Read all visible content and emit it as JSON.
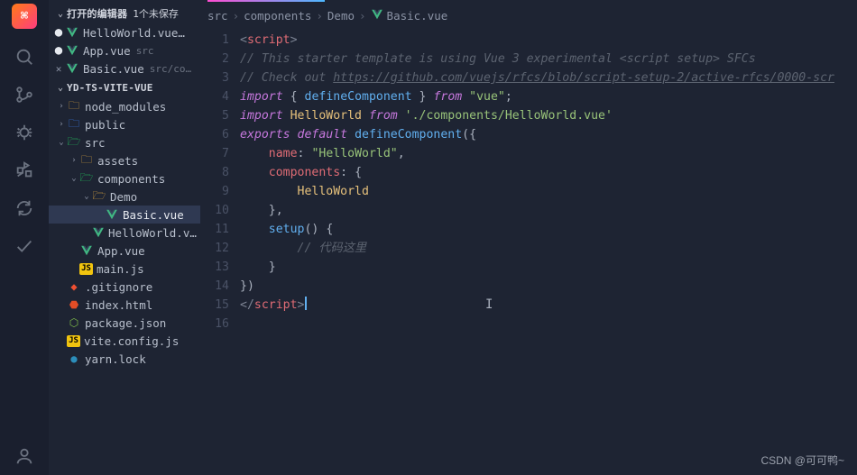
{
  "sidebar": {
    "openEditors": {
      "label": "打开的编辑器",
      "meta": "1个未保存",
      "items": [
        {
          "icon": "vue",
          "name": "HelloWorld.vue…",
          "dot": "●"
        },
        {
          "icon": "vue",
          "name": "App.vue",
          "meta": "src",
          "dot": "●"
        },
        {
          "icon": "vue",
          "name": "Basic.vue",
          "meta": "src/co…",
          "close": "✕"
        }
      ]
    },
    "project": {
      "name": "YD-TS-VITE-VUE"
    },
    "tree": [
      {
        "depth": 0,
        "chev": "›",
        "icon": "folder",
        "iconClass": "folder",
        "label": "node_modules"
      },
      {
        "depth": 0,
        "chev": "›",
        "icon": "folder",
        "iconClass": "folder-blue",
        "label": "public"
      },
      {
        "depth": 0,
        "chev": "⌄",
        "icon": "folder-open",
        "iconClass": "folder-green",
        "label": "src"
      },
      {
        "depth": 1,
        "chev": "›",
        "icon": "folder",
        "iconClass": "folder",
        "label": "assets"
      },
      {
        "depth": 1,
        "chev": "⌄",
        "icon": "folder-open",
        "iconClass": "folder-green",
        "label": "components"
      },
      {
        "depth": 2,
        "chev": "⌄",
        "icon": "folder-open",
        "iconClass": "folder",
        "label": "Demo"
      },
      {
        "depth": 3,
        "chev": "",
        "icon": "vue",
        "iconClass": "vue",
        "label": "Basic.vue",
        "selected": true
      },
      {
        "depth": 2,
        "chev": "",
        "icon": "vue",
        "iconClass": "vue",
        "label": "HelloWorld.vue"
      },
      {
        "depth": 1,
        "chev": "",
        "icon": "vue",
        "iconClass": "vue",
        "label": "App.vue"
      },
      {
        "depth": 1,
        "chev": "",
        "icon": "js",
        "iconClass": "js",
        "label": "main.js"
      },
      {
        "depth": 0,
        "chev": "",
        "icon": "git",
        "iconClass": "git",
        "label": ".gitignore"
      },
      {
        "depth": 0,
        "chev": "",
        "icon": "html",
        "iconClass": "html",
        "label": "index.html"
      },
      {
        "depth": 0,
        "chev": "",
        "icon": "json",
        "iconClass": "json",
        "label": "package.json"
      },
      {
        "depth": 0,
        "chev": "",
        "icon": "js",
        "iconClass": "js",
        "label": "vite.config.js"
      },
      {
        "depth": 0,
        "chev": "",
        "icon": "yarn",
        "iconClass": "yarn",
        "label": "yarn.lock"
      }
    ]
  },
  "breadcrumb": [
    "src",
    "components",
    "Demo",
    "Basic.vue"
  ],
  "code": {
    "lines": [
      {
        "n": 1,
        "html": ""
      },
      {
        "n": 2,
        "html": "<span class='tok-ang'>&lt;</span><span class='tok-tag'>script</span><span class='tok-ang'>&gt;</span>"
      },
      {
        "n": 3,
        "html": "<span class='tok-cmt'>// This starter template is using Vue 3 experimental &lt;script setup&gt; SFCs</span>"
      },
      {
        "n": 4,
        "html": "<span class='tok-cmt'>// Check out </span><span class='tok-link'>https://github.com/vuejs/rfcs/blob/script-setup-2/active-rfcs/0000-scr</span>"
      },
      {
        "n": 5,
        "html": "<span class='tok-key'>import</span> <span class='tok-pun'>{</span> <span class='tok-fn'>defineComponent</span> <span class='tok-pun'>}</span> <span class='tok-key'>from</span> <span class='tok-str'>\"vue\"</span><span class='tok-pun'>;</span>"
      },
      {
        "n": 6,
        "html": "<span class='tok-key'>import</span> <span class='tok-var'>HelloWorld</span> <span class='tok-key'>from</span> <span class='tok-str'>'./components/HelloWorld.vue'</span>"
      },
      {
        "n": 7,
        "html": "<span class='tok-key'>exports</span> <span class='tok-key'>default</span> <span class='tok-fn'>defineComponent</span><span class='tok-pun'>({</span>"
      },
      {
        "n": 8,
        "html": "    <span class='tok-prop'>name</span><span class='tok-pun'>:</span> <span class='tok-str'>\"HelloWorld\"</span><span class='tok-pun'>,</span>"
      },
      {
        "n": 9,
        "html": "    <span class='tok-prop'>components</span><span class='tok-pun'>:</span> <span class='tok-pun'>{</span>"
      },
      {
        "n": 10,
        "html": "        <span class='tok-var'>HelloWorld</span>"
      },
      {
        "n": 11,
        "html": "    <span class='tok-pun'>},</span>"
      },
      {
        "n": 12,
        "html": "    <span class='tok-fn'>setup</span><span class='tok-pun'>()</span> <span class='tok-pun'>{</span>"
      },
      {
        "n": 13,
        "html": "        <span class='tok-cmt'>// 代码这里</span>"
      },
      {
        "n": 14,
        "html": "    <span class='tok-pun'>}</span>"
      },
      {
        "n": 15,
        "html": "<span class='tok-pun'>})</span>"
      },
      {
        "n": 16,
        "html": "<span class='tok-ang'>&lt;/</span><span class='tok-tag'>script</span><span class='tok-ang'>&gt;</span>",
        "cursor": true
      }
    ]
  },
  "watermark": "CSDN @可可鸭~",
  "icons": {
    "vue": "V",
    "folder": "🗀",
    "folder-open": "🗁",
    "js": "JS",
    "git": "◆",
    "html": "⬣",
    "json": "⬡",
    "yarn": "●"
  }
}
